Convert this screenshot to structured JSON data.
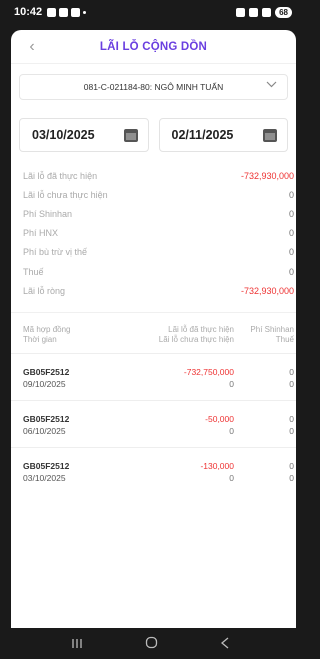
{
  "status_bar": {
    "time": "10:42",
    "battery": "68"
  },
  "header": {
    "title": "LÃI LỖ CỘNG DỒN",
    "back_glyph": "‹"
  },
  "account": {
    "selected": "081-C-021184-80: NGÔ MINH TUẤN"
  },
  "dates": {
    "from": "03/10/2025",
    "to": "02/11/2025"
  },
  "summary": [
    {
      "label": "Lãi lỗ đã thực hiện",
      "value": "-732,930,000",
      "negative": true
    },
    {
      "label": "Lãi lỗ chưa thực hiện",
      "value": "0",
      "negative": false
    },
    {
      "label": "Phí Shinhan",
      "value": "0",
      "negative": false
    },
    {
      "label": "Phí HNX",
      "value": "0",
      "negative": false
    },
    {
      "label": "Phí bù trừ vị thế",
      "value": "0",
      "negative": false
    },
    {
      "label": "Thuế",
      "value": "0",
      "negative": false
    },
    {
      "label": "Lãi lỗ ròng",
      "value": "-732,930,000",
      "negative": true
    }
  ],
  "table": {
    "headers": {
      "a1": "Mã hợp đồng",
      "a2": "Thời gian",
      "b1": "Lãi lỗ đã thực hiện",
      "b2": "Lãi lỗ chưa thực hiện",
      "c1": "Phí Shinhan",
      "c2": "Thuế"
    },
    "rows": [
      {
        "code": "GB05F2512",
        "date": "09/10/2025",
        "realized": "-732,750,000",
        "unrealized": "0",
        "fee": "0",
        "tax": "0"
      },
      {
        "code": "GB05F2512",
        "date": "06/10/2025",
        "realized": "-50,000",
        "unrealized": "0",
        "fee": "0",
        "tax": "0"
      },
      {
        "code": "GB05F2512",
        "date": "03/10/2025",
        "realized": "-130,000",
        "unrealized": "0",
        "fee": "0",
        "tax": "0"
      }
    ]
  },
  "icons": {
    "back": "chevron-left-icon",
    "dropdown": "chevron-down-icon",
    "calendar": "calendar-icon"
  },
  "colors": {
    "accent": "#6a3fe0",
    "negative": "#ee3333"
  }
}
